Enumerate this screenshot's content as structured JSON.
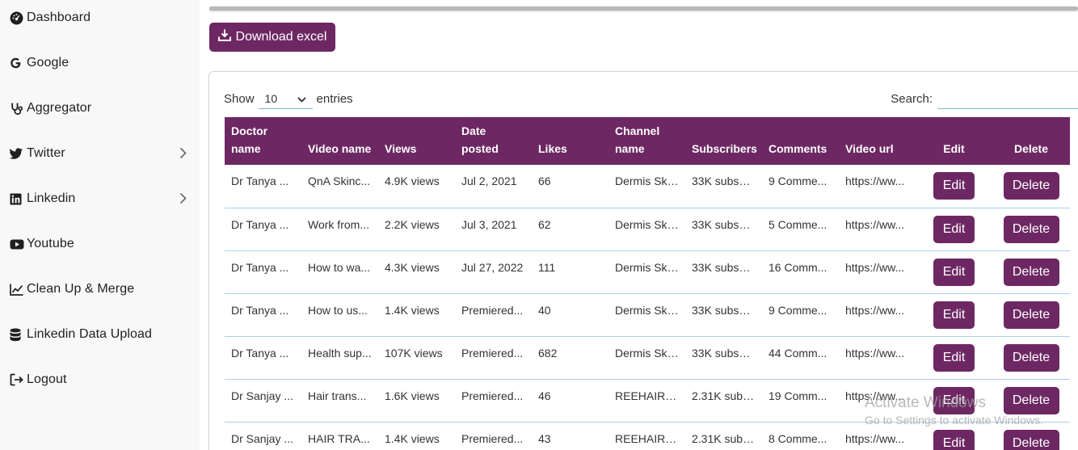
{
  "sidebar": {
    "items": [
      {
        "label": "Dashboard",
        "icon": "dashboard-icon",
        "has_chevron": false
      },
      {
        "label": "Google",
        "icon": "google-icon",
        "has_chevron": false
      },
      {
        "label": "Aggregator",
        "icon": "stethoscope-icon",
        "has_chevron": false
      },
      {
        "label": "Twitter",
        "icon": "twitter-icon",
        "has_chevron": true
      },
      {
        "label": "Linkedin",
        "icon": "linkedin-icon",
        "has_chevron": true
      },
      {
        "label": "Youtube",
        "icon": "youtube-icon",
        "has_chevron": false
      },
      {
        "label": "Clean Up & Merge",
        "icon": "line-chart-icon",
        "has_chevron": false
      },
      {
        "label": "Linkedin Data Upload",
        "icon": "database-icon",
        "has_chevron": false
      },
      {
        "label": "Logout",
        "icon": "logout-icon",
        "has_chevron": false
      }
    ]
  },
  "toolbar": {
    "download_label": "Download excel",
    "download_icon": "download-icon"
  },
  "controls": {
    "show_label": "Show",
    "entries_value": "10",
    "entries_label": "entries",
    "search_label": "Search:",
    "search_value": ""
  },
  "table": {
    "headers": [
      "Doctor name",
      "Video name",
      "Views",
      "Date posted",
      "Likes",
      "Channel name",
      "Subscribers",
      "Comments",
      "Video url",
      "Edit",
      "Delete"
    ],
    "rows": [
      [
        "Dr Tanya ...",
        "QnA Skinc...",
        "4.9K views",
        "Jul 2, 2021",
        "66",
        "Dermis Ski...",
        "33K subscr...",
        "9 Comme...",
        "https://ww..."
      ],
      [
        "Dr Tanya ...",
        "Work from...",
        "2.2K views",
        "Jul 3, 2021",
        "62",
        "Dermis Ski...",
        "33K subscr...",
        "5 Comme...",
        "https://ww..."
      ],
      [
        "Dr Tanya ...",
        "How to wa...",
        "4.3K views",
        "Jul 27, 2022",
        "111",
        "Dermis Ski...",
        "33K subscr...",
        "16 Comm...",
        "https://ww..."
      ],
      [
        "Dr Tanya ...",
        "How to us...",
        "1.4K views",
        "Premiered...",
        "40",
        "Dermis Ski...",
        "33K subscr...",
        "9 Comme...",
        "https://ww..."
      ],
      [
        "Dr Tanya ...",
        "Health sup...",
        "107K views",
        "Premiered...",
        "682",
        "Dermis Ski...",
        "33K subscr...",
        "44 Comm...",
        "https://ww..."
      ],
      [
        "Dr Sanjay ...",
        "Hair trans...",
        "1.6K views",
        "Premiered...",
        "46",
        "REEHAIRS...",
        "2.31K subs...",
        "19 Comm...",
        "https://ww..."
      ],
      [
        "Dr Sanjay ...",
        "HAIR TRA...",
        "1.4K views",
        "Premiered...",
        "43",
        "REEHAIRS...",
        "2.31K subs...",
        "8 Comme...",
        "https://ww..."
      ]
    ],
    "edit_label": "Edit",
    "delete_label": "Delete"
  },
  "watermark": {
    "title": "Activate Windows",
    "subtitle": "Go to Settings to activate Windows."
  },
  "colors": {
    "accent": "#6d2863",
    "row_border": "#a9d2e6",
    "sidebar_bg": "#f8f8f8"
  }
}
